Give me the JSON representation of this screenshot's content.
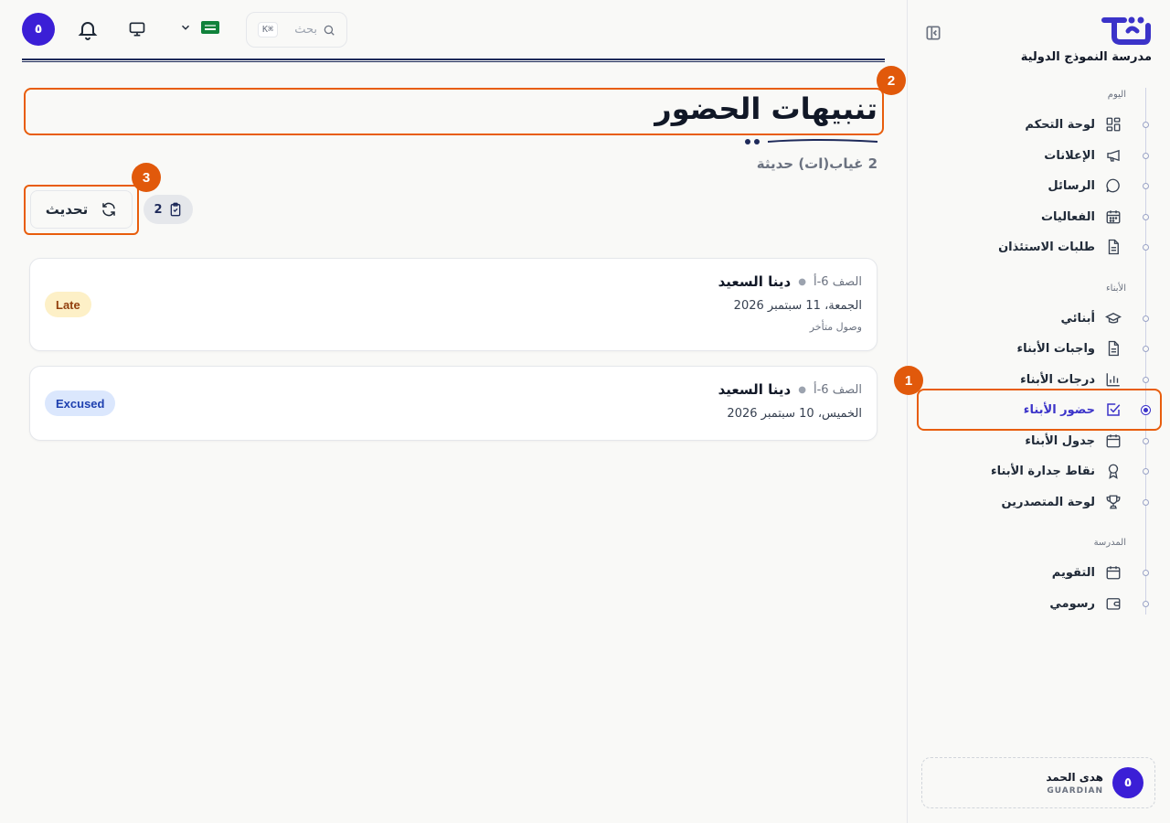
{
  "topbar": {
    "avatar_initial": "٥",
    "search_placeholder": "بحث",
    "search_shortcut": "K⌘"
  },
  "sidebar": {
    "school_name": "مدرسة النموذج الدولية",
    "sections": [
      {
        "heading": "اليوم",
        "items": [
          {
            "label": "لوحة التحكم",
            "icon": "dashboard-icon"
          },
          {
            "label": "الإعلانات",
            "icon": "megaphone-icon"
          },
          {
            "label": "الرسائل",
            "icon": "message-icon"
          },
          {
            "label": "الفعاليات",
            "icon": "calendar-grid-icon"
          },
          {
            "label": "طلبات الاستئذان",
            "icon": "document-icon"
          }
        ]
      },
      {
        "heading": "الأبناء",
        "items": [
          {
            "label": "أبنائي",
            "icon": "graduation-cap-icon"
          },
          {
            "label": "واجبات الأبناء",
            "icon": "document-icon"
          },
          {
            "label": "درجات الأبناء",
            "icon": "bar-chart-icon"
          },
          {
            "label": "حضور الأبناء",
            "icon": "check-square-icon",
            "active": true
          },
          {
            "label": "جدول الأبناء",
            "icon": "calendar-icon"
          },
          {
            "label": "نقاط جدارة الأبناء",
            "icon": "award-icon"
          },
          {
            "label": "لوحة المتصدرين",
            "icon": "trophy-icon"
          }
        ]
      },
      {
        "heading": "المدرسة",
        "items": [
          {
            "label": "التقويم",
            "icon": "calendar-icon"
          },
          {
            "label": "رسومي",
            "icon": "wallet-icon"
          }
        ]
      }
    ],
    "user": {
      "initial": "٥",
      "name": "هدى الحمد",
      "role": "GUARDIAN"
    }
  },
  "main": {
    "title": "تنبيهات الحضور",
    "subtitle": "2 غياب(ات) حديثة",
    "refresh_label": "تحديث",
    "count": "2",
    "alerts": [
      {
        "name": "دينا السعيد",
        "class": "الصف 6-أ",
        "date": "الجمعة، 11 سبتمبر 2026",
        "note": "وصول متأخر",
        "status": "Late"
      },
      {
        "name": "دينا السعيد",
        "class": "الصف 6-أ",
        "date": "الخميس، 10 سبتمبر 2026",
        "note": "",
        "status": "Excused"
      }
    ]
  },
  "annotations": [
    "1",
    "2",
    "3"
  ],
  "colors": {
    "accent": "#3b33c9",
    "highlight": "#e85d0c",
    "late_bg": "#fdf0c7",
    "excused_bg": "#dbe7fd"
  }
}
